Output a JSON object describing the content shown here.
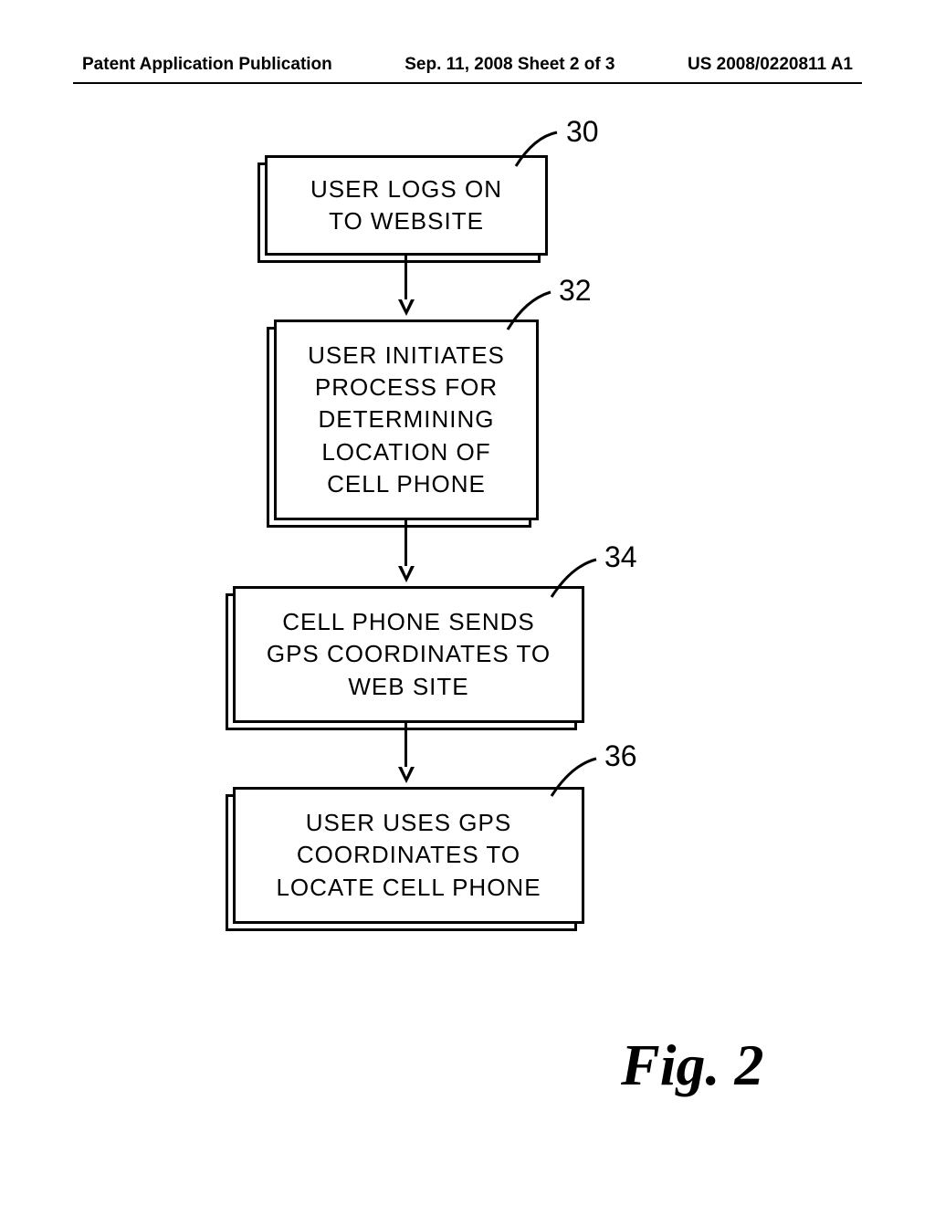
{
  "header": {
    "left": "Patent Application Publication",
    "mid": "Sep. 11, 2008  Sheet 2 of 3",
    "right": "US 2008/0220811 A1"
  },
  "flowchart": {
    "boxes": [
      {
        "ref": "30",
        "text": "USER LOGS ON\nTO WEBSITE"
      },
      {
        "ref": "32",
        "text": "USER INITIATES\nPROCESS FOR\nDETERMINING\nLOCATION OF\nCELL PHONE"
      },
      {
        "ref": "34",
        "text": "CELL PHONE SENDS\nGPS COORDINATES TO\nWEB SITE"
      },
      {
        "ref": "36",
        "text": "USER USES GPS\nCOORDINATES TO\nLOCATE CELL PHONE"
      }
    ]
  },
  "figure_label": "Fig. 2"
}
